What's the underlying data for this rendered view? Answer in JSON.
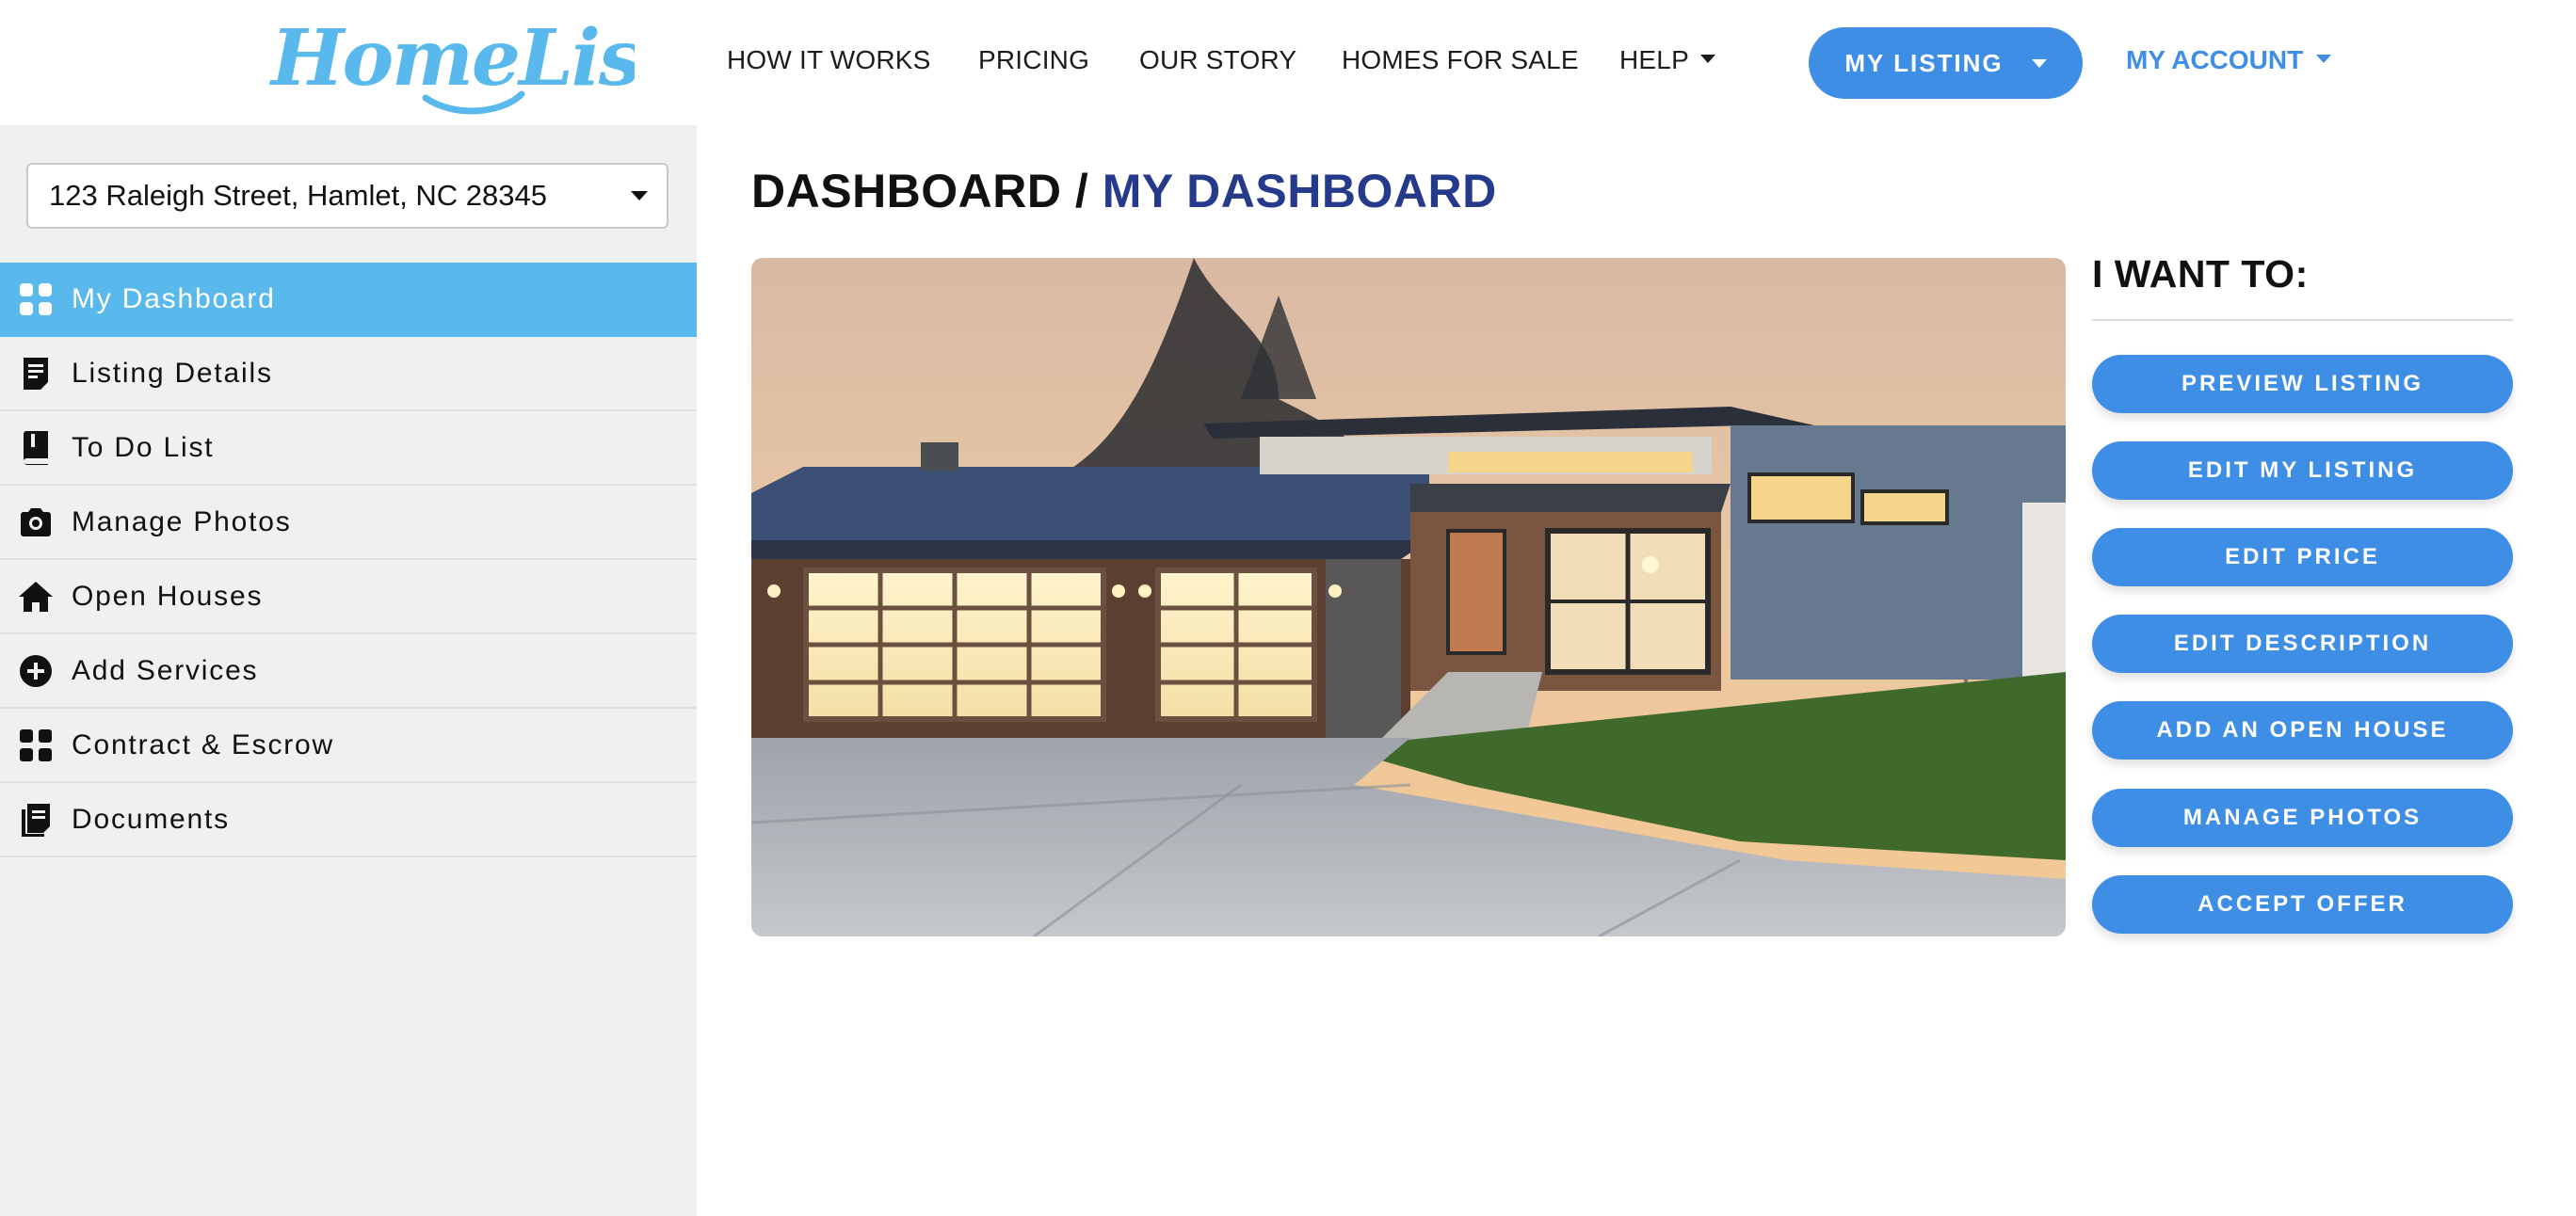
{
  "header": {
    "logo_text": "HomeLister",
    "nav": [
      {
        "label": "HOW IT WORKS"
      },
      {
        "label": "PRICING"
      },
      {
        "label": "OUR STORY"
      },
      {
        "label": "HOMES FOR SALE"
      },
      {
        "label": "HELP"
      }
    ],
    "my_listing_label": "MY LISTING",
    "my_account_label": "MY ACCOUNT"
  },
  "sidebar": {
    "selected_address": "123 Raleigh Street, Hamlet, NC 28345",
    "items": [
      {
        "label": "My Dashboard",
        "icon": "grid-icon",
        "active": true
      },
      {
        "label": "Listing Details",
        "icon": "document-icon"
      },
      {
        "label": "To Do List",
        "icon": "book-icon"
      },
      {
        "label": "Manage Photos",
        "icon": "camera-icon"
      },
      {
        "label": "Open Houses",
        "icon": "home-icon"
      },
      {
        "label": "Add Services",
        "icon": "plus-circle-icon"
      },
      {
        "label": "Contract & Escrow",
        "icon": "grid-icon"
      },
      {
        "label": "Documents",
        "icon": "documents-icon"
      }
    ]
  },
  "main": {
    "breadcrumb_root": "DASHBOARD / ",
    "breadcrumb_current": "MY DASHBOARD",
    "want_title": "I WANT TO:",
    "actions": [
      {
        "label": "PREVIEW LISTING"
      },
      {
        "label": "EDIT MY LISTING"
      },
      {
        "label": "EDIT PRICE"
      },
      {
        "label": "EDIT DESCRIPTION"
      },
      {
        "label": "ADD AN OPEN HOUSE"
      },
      {
        "label": "MANAGE PHOTOS"
      },
      {
        "label": "ACCEPT OFFER"
      }
    ]
  },
  "colors": {
    "brand_blue": "#3e8ee6",
    "active_blue": "#5ab9ec",
    "breadcrumb_navy": "#263a8c",
    "logo_blue": "#5ab9ec",
    "sidebar_bg": "#f0f0f0"
  }
}
